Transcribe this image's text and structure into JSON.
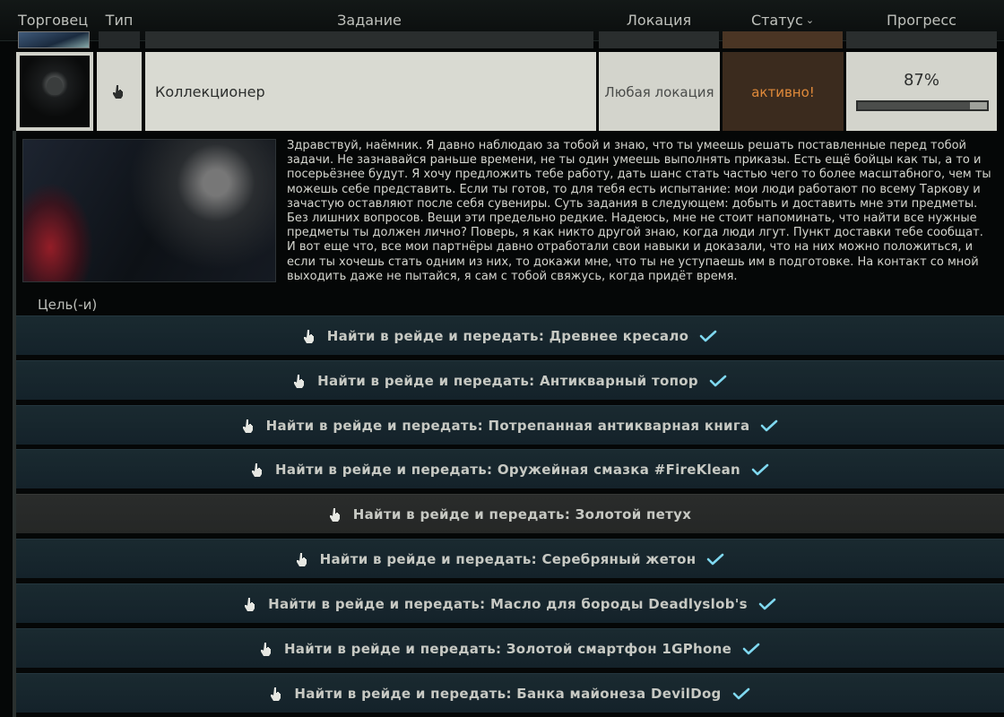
{
  "header": {
    "trader": "Торговец",
    "type": "Тип",
    "task": "Задание",
    "location": "Локация",
    "status": "Статус",
    "progress": "Прогресс"
  },
  "task": {
    "name": "Коллекционер",
    "location": "Любая локация",
    "status": "активно!",
    "progress_label": "87%",
    "progress_value": 0.87
  },
  "description": "Здравствуй, наёмник. Я давно наблюдаю за тобой и знаю, что ты умеешь решать поставленные перед тобой задачи. Не зазнавайся раньше времени, не ты один умеешь выполнять приказы. Есть ещё бойцы как ты, а то и посерьёзнее будут. Я хочу предложить тебе работу, дать шанс стать частью чего то более масштабного, чем ты можешь себе представить. Если ты готов, то для тебя есть испытание: мои люди работают по всему Таркову и зачастую оставляют после себя сувениры. Суть задания в следующем: добыть и доставить мне эти предметы. Без лишних вопросов. Вещи эти предельно редкие. Надеюсь, мне не стоит напоминать, что найти все нужные предметы ты должен лично? Поверь, я как никто другой знаю, когда люди лгут. Пункт доставки тебе сообщат. И вот еще что, все мои партнёры давно отработали свои навыки и доказали, что на них можно положиться, и если ты хочешь стать одним из них, то докажи мне, что ты не уступаешь им в подготовке. На контакт со мной выходить даже не пытайся, я сам с тобой свяжусь, когда придёт время.",
  "goals_label": "Цель(-и)",
  "objectives": [
    {
      "label": "Найти в рейде и передать: Древнее кресало",
      "done": true
    },
    {
      "label": "Найти в рейде и передать: Антикварный топор",
      "done": true
    },
    {
      "label": "Найти в рейде и передать: Потрепанная антикварная книга",
      "done": true
    },
    {
      "label": "Найти в рейде и передать: Оружейная смазка #FireKlean",
      "done": true
    },
    {
      "label": "Найти в рейде и передать: Золотой петух",
      "done": false
    },
    {
      "label": "Найти в рейде и передать: Серебряный жетон",
      "done": true
    },
    {
      "label": "Найти в рейде и передать: Масло для бороды Deadlyslob's",
      "done": true
    },
    {
      "label": "Найти в рейде и передать: Золотой смартфон 1GPhone",
      "done": true
    },
    {
      "label": "Найти в рейде и передать: Банка майонеза DevilDog",
      "done": true
    }
  ],
  "colors": {
    "status_active": "#e08a3a",
    "check": "#7fd8f0"
  },
  "icons": {
    "type": "hand-pointer-icon",
    "check": "checkmark-icon"
  }
}
